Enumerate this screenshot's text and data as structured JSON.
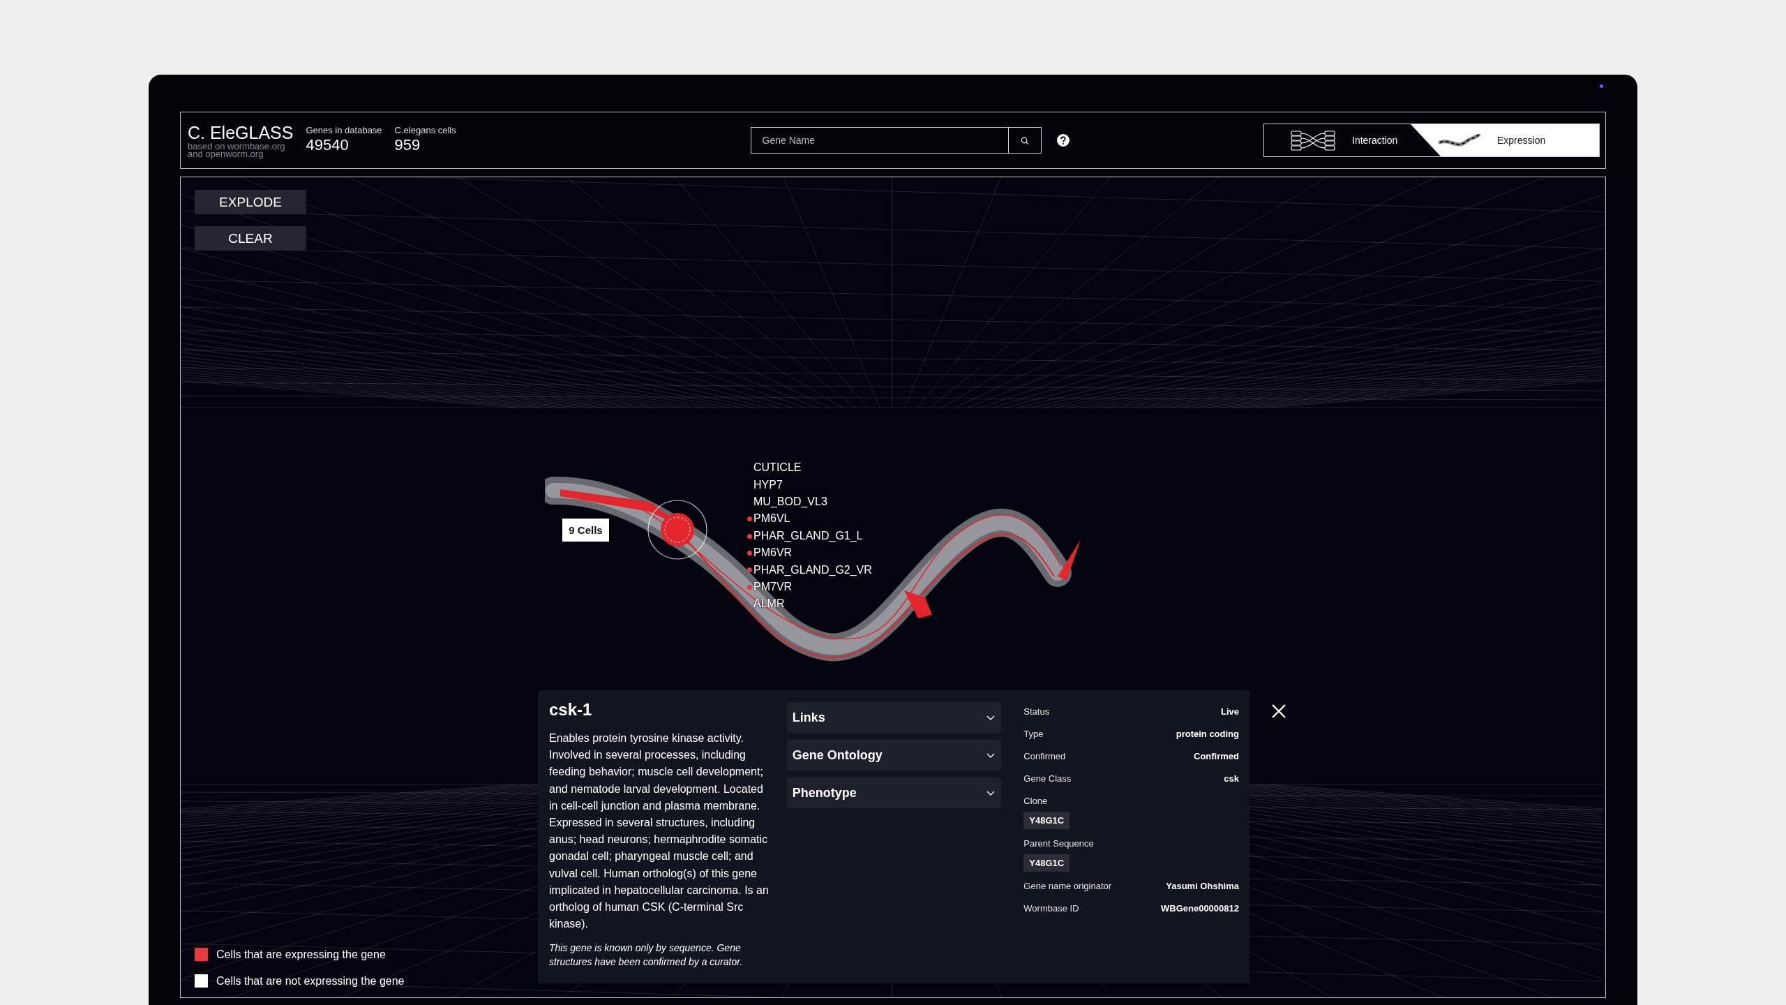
{
  "header": {
    "logo": "C. EleGLASS",
    "subtitle": "based on wormbase.org and openworm.org",
    "stats": [
      {
        "label": "Genes in database",
        "value": "49540"
      },
      {
        "label": "C.elegans cells",
        "value": "959"
      }
    ],
    "search": {
      "placeholder": "Gene Name"
    },
    "view_tabs": [
      {
        "label": "Interaction",
        "kind": "interaction",
        "selected": false
      },
      {
        "label": "Expression",
        "kind": "expression",
        "selected": true
      }
    ]
  },
  "controls": {
    "buttons": [
      "EXPLODE",
      "CLEAR"
    ]
  },
  "scene": {
    "cell_count_tag": "9 Cells",
    "cells": [
      {
        "name": "CUTICLE",
        "expressed": false
      },
      {
        "name": "HYP7",
        "expressed": false
      },
      {
        "name": "MU_BOD_VL3",
        "expressed": false
      },
      {
        "name": "PM6VL",
        "expressed": true
      },
      {
        "name": "PHAR_GLAND_G1_L",
        "expressed": true
      },
      {
        "name": "PM6VR",
        "expressed": true
      },
      {
        "name": "PHAR_GLAND_G2_VR",
        "expressed": true
      },
      {
        "name": "PM7VR",
        "expressed": true
      },
      {
        "name": "ALMR",
        "expressed": false
      }
    ]
  },
  "gene": {
    "name": "csk-1",
    "description": "Enables protein tyrosine kinase activity. Involved in several processes, including feeding behavior; muscle cell development; and nematode larval development. Located in cell-cell junction and plasma membrane. Expressed in several structures, including anus; head neurons; hermaphrodite somatic gonadal cell; pharyngeal muscle cell; and vulval cell. Human ortholog(s) of this gene implicated in hepatocellular carcinoma. Is an ortholog of human CSK (C-terminal Src kinase).",
    "note": "This gene is known only by sequence. Gene structures have been confirmed by a curator.",
    "sections": [
      {
        "label": "Links",
        "expanded": false
      },
      {
        "label": "Gene Ontology",
        "expanded": false
      },
      {
        "label": "Phenotype",
        "expanded": false
      }
    ],
    "properties": [
      {
        "kind": "pair",
        "label": "Status",
        "value": "Live"
      },
      {
        "kind": "pair",
        "label": "Type",
        "value": "protein coding"
      },
      {
        "kind": "pair",
        "label": "Confirmed",
        "value": "Confirmed"
      },
      {
        "kind": "pair",
        "label": "Gene Class",
        "value": "csk"
      },
      {
        "kind": "chip",
        "label": "Clone",
        "value": "Y48G1C"
      },
      {
        "kind": "chip",
        "label": "Parent Sequence",
        "value": "Y48G1C"
      },
      {
        "kind": "pair",
        "label": "Gene name originator",
        "value": "Yasumi Ohshima"
      },
      {
        "kind": "pair",
        "label": "Wormbase ID",
        "value": "WBGene00000812"
      }
    ]
  },
  "legend": [
    {
      "label": "Cells that are expressing the gene",
      "color": "#e8393f"
    },
    {
      "label": "Cells that are not expressing the gene",
      "color": "#ffffff"
    }
  ]
}
